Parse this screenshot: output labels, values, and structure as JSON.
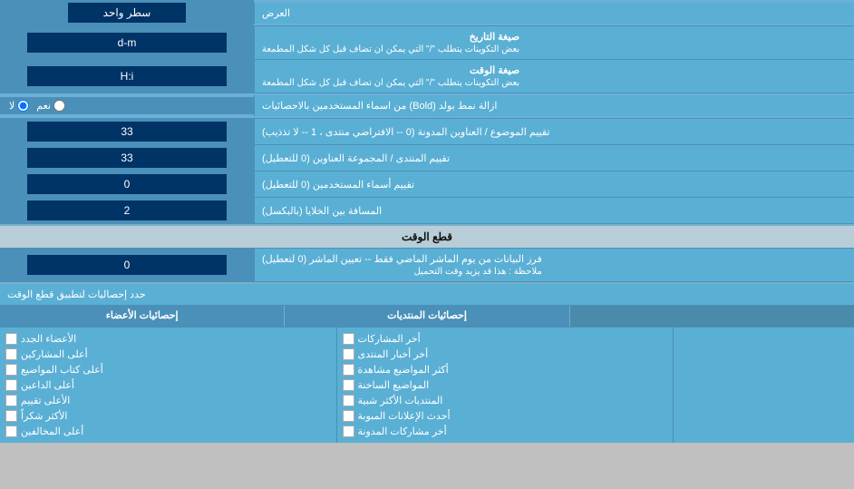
{
  "page": {
    "display_label": "العرض",
    "display_options": [
      "سطر واحد"
    ],
    "display_selected": "سطر واحد",
    "date_format_label": "صيغة التاريخ",
    "date_format_sublabel": "بعض التكوينات يتطلب \"/\" التي يمكن ان تضاف قبل كل شكل المطمعة",
    "date_format_value": "d-m",
    "time_format_label": "صيغة الوقت",
    "time_format_sublabel": "بعض التكوينات يتطلب \"/\" التي يمكن ان تضاف قبل كل شكل المطمعة",
    "time_format_value": "H:i",
    "bold_label": "ازالة نمط بولد (Bold) من اسماء المستخدمين بالاحصائيات",
    "bold_radio1": "نعم",
    "bold_radio2": "لا",
    "topics_label": "تقييم الموضوع / العناوين المدونة (0 -- الافتراضي منتدى ، 1 -- لا تذذيب)",
    "topics_value": "33",
    "forum_label": "تقييم المنتدى / المجموعة العناوين (0 للتعطيل)",
    "forum_value": "33",
    "users_label": "تقييم أسماء المستخدمين (0 للتعطيل)",
    "users_value": "0",
    "gap_label": "المسافة بين الخلايا (بالبكسل)",
    "gap_value": "2",
    "section_qata": "قطع الوقت",
    "filter_label": "فرز البيانات من يوم الماشر الماضي فقط -- تعيين الماشر (0 لتعطيل)",
    "filter_sublabel": "ملاحظة : هذا قد يزيد وقت التحميل",
    "filter_value": "0",
    "limit_label": "حدد إحصاليات لتطبيق قطع الوقت",
    "stats_headers": {
      "col1": "",
      "col2": "إحصائيات المنتديات",
      "col3": "إحصائيات الأعضاء"
    },
    "col2_items": [
      {
        "label": "أخر المشاركات",
        "checked": false
      },
      {
        "label": "أخر أخبار المنتدى",
        "checked": false
      },
      {
        "label": "أكثر المواضيع مشاهدة",
        "checked": false
      },
      {
        "label": "المواضيع الساخنة",
        "checked": false
      },
      {
        "label": "المنتديات الأكثر شبية",
        "checked": false
      },
      {
        "label": "أحدث الإعلانات المبوبة",
        "checked": false
      },
      {
        "label": "أخر مشاركات المدونة",
        "checked": false
      }
    ],
    "col3_items": [
      {
        "label": "الأعضاء الجدد",
        "checked": false
      },
      {
        "label": "أعلى المشاركين",
        "checked": false
      },
      {
        "label": "أعلى كتاب المواضيع",
        "checked": false
      },
      {
        "label": "أعلى الداعين",
        "checked": false
      },
      {
        "label": "الأعلى تقييم",
        "checked": false
      },
      {
        "label": "الأكثر شكراً",
        "checked": false
      },
      {
        "label": "أعلى المخالفين",
        "checked": false
      }
    ]
  }
}
